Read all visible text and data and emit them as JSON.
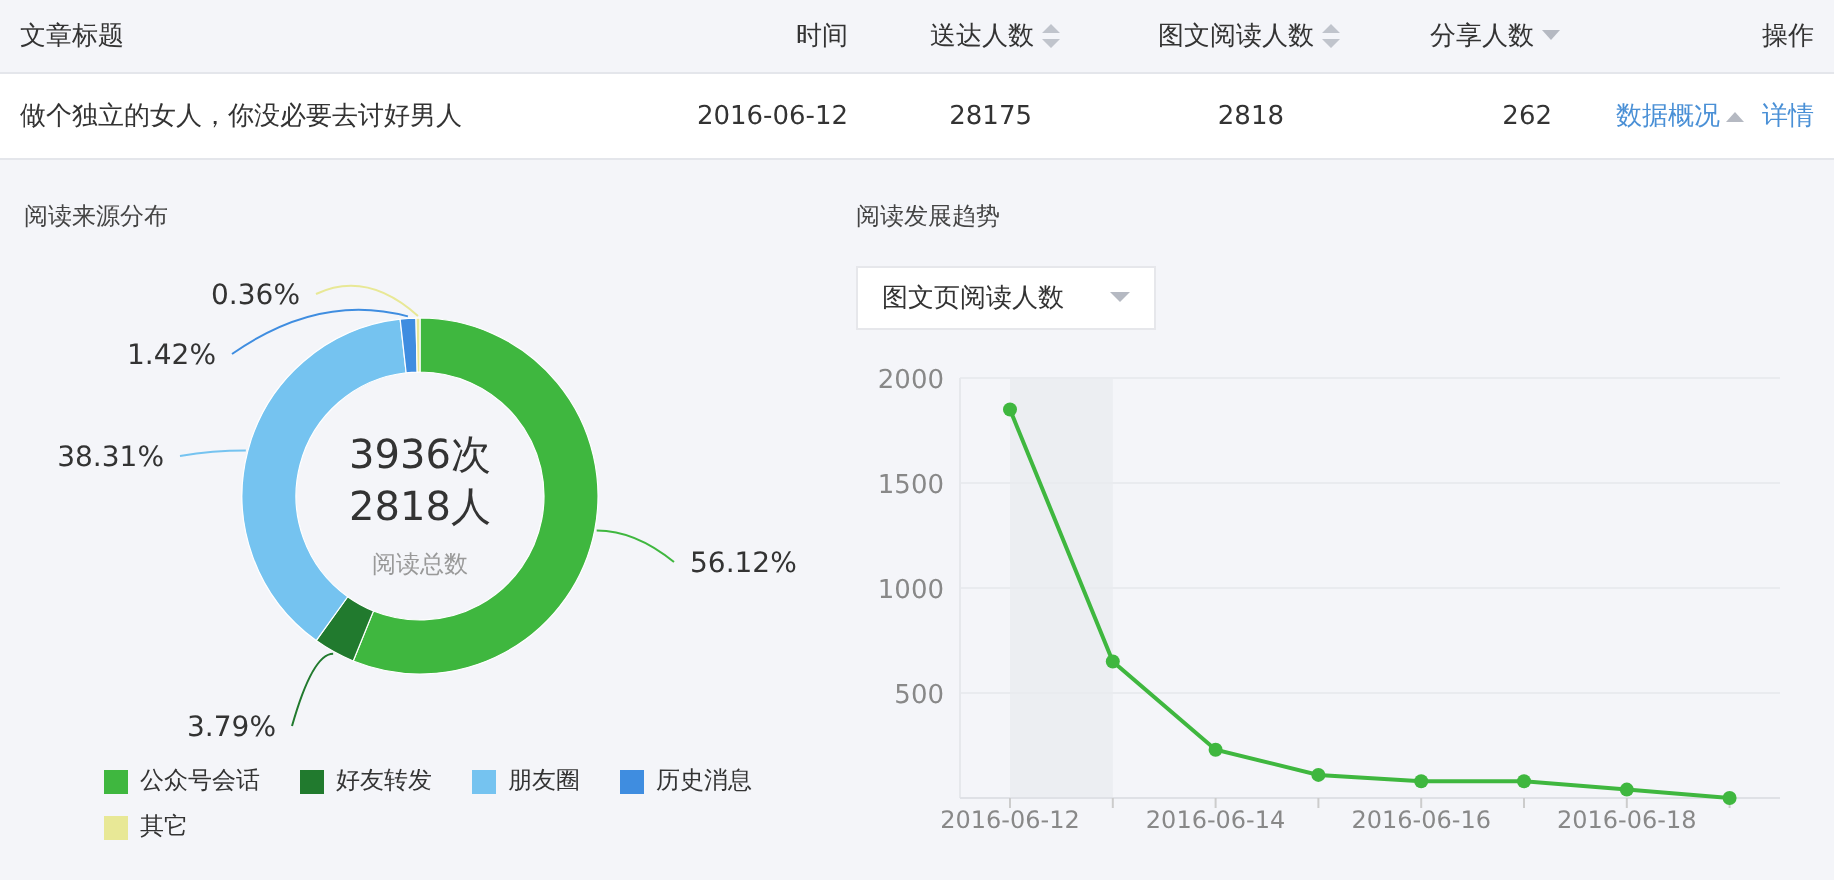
{
  "table": {
    "columns": [
      {
        "label": "文章标题",
        "kind": "plain"
      },
      {
        "label": "时间",
        "kind": "plain"
      },
      {
        "label": "送达人数",
        "kind": "sortable"
      },
      {
        "label": "图文阅读人数",
        "kind": "sortable"
      },
      {
        "label": "分享人数",
        "kind": "sorted"
      },
      {
        "label": "操作",
        "kind": "plain"
      }
    ],
    "rows": [
      {
        "title": "做个独立的女人，你没必要去讨好男人",
        "date": "2016-06-12",
        "delivered": "28175",
        "readers": "2818",
        "shares": "262",
        "overview_link": {
          "label": "数据概况",
          "expanded": true
        },
        "details_link": "详情"
      }
    ]
  },
  "source_panel": {
    "title": "阅读来源分布",
    "center_lines": [
      "3936次",
      "2818人"
    ],
    "center_caption": "阅读总数",
    "chart_data": {
      "type": "donut",
      "categories": [
        "公众号会话",
        "好友转发",
        "朋友圈",
        "历史消息",
        "其它"
      ],
      "values": [
        56.12,
        3.79,
        38.31,
        1.42,
        0.36
      ],
      "value_labels": [
        "56.12%",
        "3.79%",
        "38.31%",
        "1.42%",
        "0.36%"
      ],
      "colors": [
        "#3fb73f",
        "#217a2e",
        "#75c3f0",
        "#3f8de0",
        "#e8e896"
      ]
    }
  },
  "trend_panel": {
    "title": "阅读发展趋势",
    "chart_data": {
      "type": "line",
      "grid": true,
      "categories": [
        "2016-06-12",
        null,
        "2016-06-14",
        null,
        "2016-06-16",
        null,
        "2016-06-18",
        null
      ],
      "ylim": [
        0,
        2000
      ],
      "yticks": [
        500,
        1000,
        1500,
        2000
      ],
      "series": [
        {
          "name": "图文页阅读人数",
          "color": "#3fb73f",
          "marker": true,
          "values": [
            1850,
            650,
            230,
            110,
            80,
            80,
            40,
            0
          ]
        }
      ]
    }
  }
}
